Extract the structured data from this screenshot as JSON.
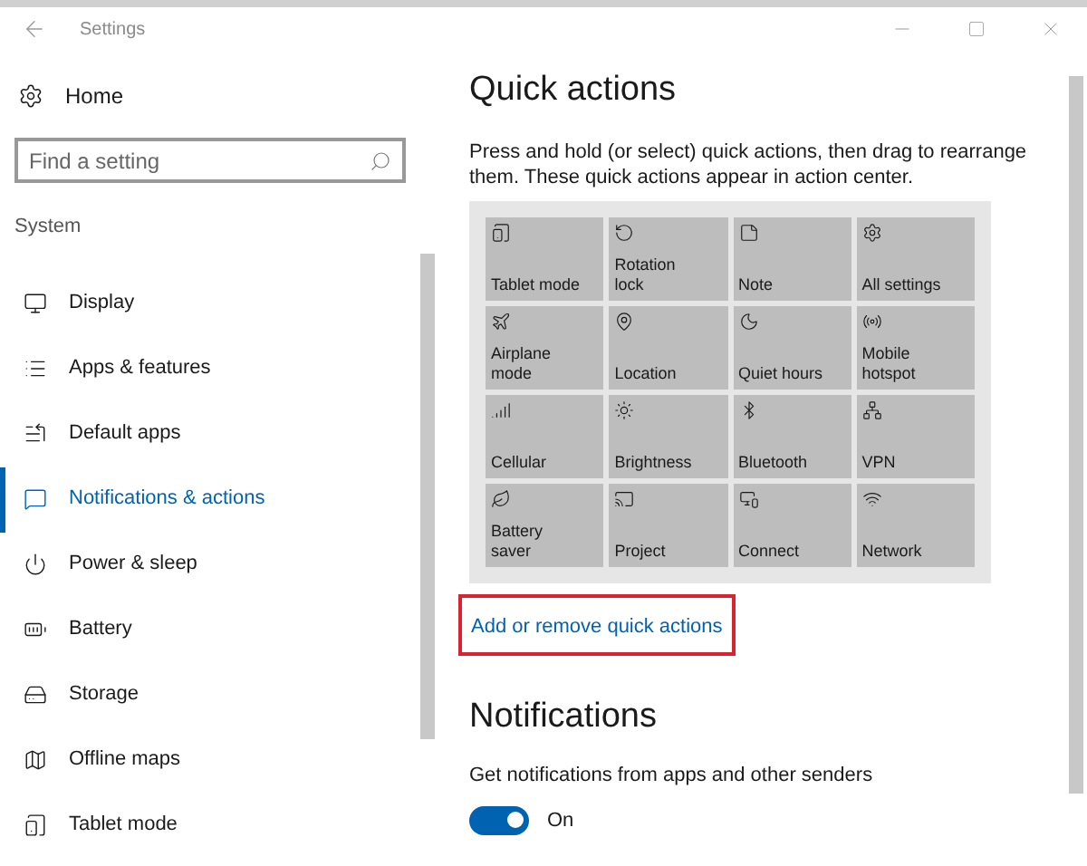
{
  "window": {
    "title": "Settings"
  },
  "sidebar": {
    "home": "Home",
    "search": {
      "placeholder": "Find a setting"
    },
    "section": "System",
    "items": [
      {
        "label": "Display",
        "selected": false
      },
      {
        "label": "Apps & features",
        "selected": false
      },
      {
        "label": "Default apps",
        "selected": false
      },
      {
        "label": "Notifications & actions",
        "selected": true
      },
      {
        "label": "Power & sleep",
        "selected": false
      },
      {
        "label": "Battery",
        "selected": false
      },
      {
        "label": "Storage",
        "selected": false
      },
      {
        "label": "Offline maps",
        "selected": false
      },
      {
        "label": "Tablet mode",
        "selected": false
      }
    ]
  },
  "quick_actions": {
    "title": "Quick actions",
    "description": "Press and hold (or select) quick actions, then drag to rearrange them. These quick actions appear in action center.",
    "tiles": [
      {
        "label": "Tablet mode"
      },
      {
        "label": "Rotation lock"
      },
      {
        "label": "Note"
      },
      {
        "label": "All settings"
      },
      {
        "label": "Airplane mode"
      },
      {
        "label": "Location"
      },
      {
        "label": "Quiet hours"
      },
      {
        "label": "Mobile hotspot"
      },
      {
        "label": "Cellular"
      },
      {
        "label": "Brightness"
      },
      {
        "label": "Bluetooth"
      },
      {
        "label": "VPN"
      },
      {
        "label": "Battery saver"
      },
      {
        "label": "Project"
      },
      {
        "label": "Connect"
      },
      {
        "label": "Network"
      }
    ],
    "link": {
      "label": "Add or remove quick actions",
      "highlighted": true
    }
  },
  "notifications": {
    "title": "Notifications",
    "setting": "Get notifications from apps and other senders",
    "toggle": {
      "on": true,
      "label": "On"
    }
  }
}
